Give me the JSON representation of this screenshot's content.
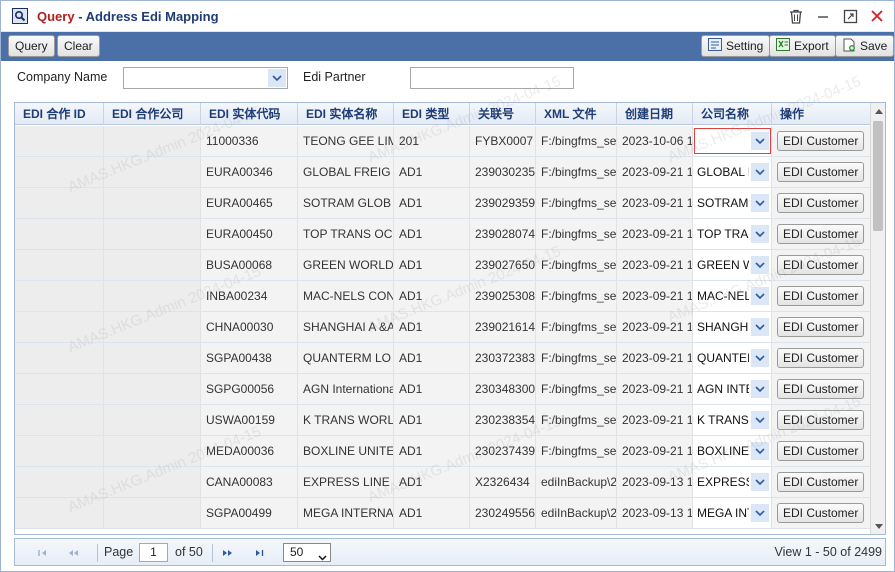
{
  "window": {
    "title_prefix": "Query",
    "title_rest": " - Address Edi Mapping",
    "icons": [
      "search-window-icon",
      "trash-icon",
      "minimize-icon",
      "maximize-icon",
      "close-icon"
    ]
  },
  "toolbar": {
    "query": "Query",
    "clear": "Clear",
    "setting": "Setting",
    "export": "Export",
    "save": "Save"
  },
  "filter": {
    "company_label": "Company Name",
    "company_value": "",
    "partner_label": "Edi Partner",
    "partner_value": ""
  },
  "grid": {
    "columns": [
      "EDI 合作 ID",
      "EDI 合作公司",
      "EDI 实体代码",
      "EDI 实体名称",
      "EDI 类型",
      "关联号",
      "XML 文件",
      "创建日期",
      "公司名称",
      "操作"
    ],
    "action_label": "EDI Customer",
    "rows": [
      {
        "code": "11000336",
        "name": "TEONG GEE LIM",
        "type": "201",
        "ref": "FYBX0007",
        "xml": "F:/bingfms_se",
        "date": "2023-10-06 1",
        "company": ""
      },
      {
        "code": "EURA00346",
        "name": "GLOBAL FREIG",
        "type": "AD1",
        "ref": "239030235",
        "xml": "F:/bingfms_se",
        "date": "2023-09-21 1",
        "company": "GLOBAL F"
      },
      {
        "code": "EURA00465",
        "name": "SOTRAM GLOB",
        "type": "AD1",
        "ref": "239029359",
        "xml": "F:/bingfms_se",
        "date": "2023-09-21 1",
        "company": "SOTRAM"
      },
      {
        "code": "EURA00450",
        "name": "TOP TRANS OC",
        "type": "AD1",
        "ref": "239028074",
        "xml": "F:/bingfms_se",
        "date": "2023-09-21 1",
        "company": "TOP TRA"
      },
      {
        "code": "BUSA00068",
        "name": "GREEN WORLD",
        "type": "AD1",
        "ref": "239027650",
        "xml": "F:/bingfms_se",
        "date": "2023-09-21 1",
        "company": "GREEN W"
      },
      {
        "code": "INBA00234",
        "name": "MAC-NELS CON",
        "type": "AD1",
        "ref": "239025308",
        "xml": "F:/bingfms_se",
        "date": "2023-09-21 1",
        "company": "MAC-NEL"
      },
      {
        "code": "CHNA00030",
        "name": "SHANGHAI A &A",
        "type": "AD1",
        "ref": "239021614",
        "xml": "F:/bingfms_se",
        "date": "2023-09-21 1",
        "company": "SHANGH"
      },
      {
        "code": "SGPA00438",
        "name": "QUANTERM LO",
        "type": "AD1",
        "ref": "230372383",
        "xml": "F:/bingfms_se",
        "date": "2023-09-21 1",
        "company": "QUANTEI"
      },
      {
        "code": "SGPG00056",
        "name": "AGN International",
        "type": "AD1",
        "ref": "230348300",
        "xml": "F:/bingfms_se",
        "date": "2023-09-21 1",
        "company": "AGN INTE"
      },
      {
        "code": "USWA00159",
        "name": "K TRANS WORL",
        "type": "AD1",
        "ref": "230238354",
        "xml": "F:/bingfms_se",
        "date": "2023-09-21 1",
        "company": "K TRANS"
      },
      {
        "code": "MEDA00036",
        "name": "BOXLINE UNITE",
        "type": "AD1",
        "ref": "230237439",
        "xml": "F:/bingfms_se",
        "date": "2023-09-21 1",
        "company": "BOXLINE"
      },
      {
        "code": "CANA00083",
        "name": "EXPRESS LINE",
        "type": "AD1",
        "ref": "X2326434",
        "xml": "ediInBackup\\2",
        "date": "2023-09-13 1",
        "company": "EXPRESS"
      },
      {
        "code": "SGPA00499",
        "name": "MEGA INTERNA",
        "type": "AD1",
        "ref": "230249556",
        "xml": "ediInBackup\\2",
        "date": "2023-09-13 1",
        "company": "MEGA INT"
      }
    ]
  },
  "pager": {
    "page_label": "Page",
    "page_value": "1",
    "of_label": "of 50",
    "page_size": "50",
    "summary": "View 1 - 50 of 2499"
  },
  "watermark": {
    "text": "AMAS.HKG.Admin 2024-04-15"
  },
  "colors": {
    "toolbar_bg": "#4b70a8",
    "title_accent": "#b02020",
    "title_text": "#1f3c75",
    "focus_border": "#e04040"
  }
}
